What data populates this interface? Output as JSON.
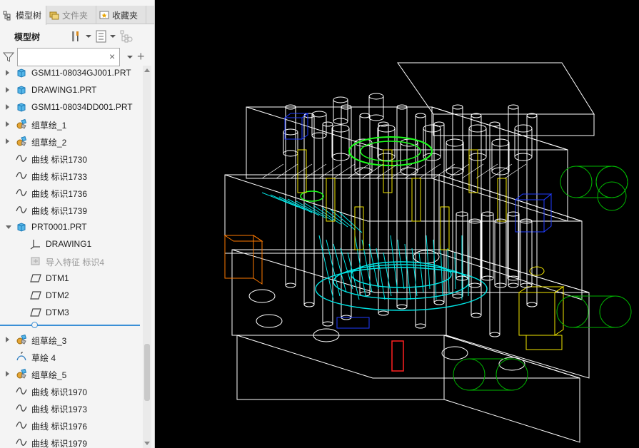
{
  "tabs": [
    {
      "label": "模型树",
      "icon": "model-tree-icon"
    },
    {
      "label": "文件夹",
      "icon": "folder-browser-icon"
    },
    {
      "label": "收藏夹",
      "icon": "favorites-icon"
    }
  ],
  "toolbar": {
    "title": "模型树",
    "settings_icon": "tools-icon",
    "show_icon": "list-settings-icon",
    "extra_icon": "tree-columns-icon"
  },
  "filter": {
    "value": "",
    "placeholder": "",
    "clear_glyph": "×",
    "add_glyph": "+"
  },
  "tree": [
    {
      "label": "GSM11-08034GJ001.PRT",
      "icon": "part-icon",
      "indent": 0,
      "exp": "closed"
    },
    {
      "label": "DRAWING1.PRT",
      "icon": "part-icon",
      "indent": 0,
      "exp": "closed"
    },
    {
      "label": "GSM11-08034DD001.PRT",
      "icon": "part-icon",
      "indent": 0,
      "exp": "closed"
    },
    {
      "label": "组草绘_1",
      "icon": "group-icon",
      "indent": 0,
      "exp": "closed"
    },
    {
      "label": "组草绘_2",
      "icon": "group-icon",
      "indent": 0,
      "exp": "closed"
    },
    {
      "label": "曲线 标识1730",
      "icon": "curve-icon",
      "indent": 0,
      "exp": "none"
    },
    {
      "label": "曲线 标识1733",
      "icon": "curve-icon",
      "indent": 0,
      "exp": "none"
    },
    {
      "label": "曲线 标识1736",
      "icon": "curve-icon",
      "indent": 0,
      "exp": "none"
    },
    {
      "label": "曲线 标识1739",
      "icon": "curve-icon",
      "indent": 0,
      "exp": "none"
    },
    {
      "label": "PRT0001.PRT",
      "icon": "part-icon",
      "indent": 0,
      "exp": "open"
    },
    {
      "label": "DRAWING1",
      "icon": "csys-icon",
      "indent": 1,
      "exp": "none"
    },
    {
      "label": "导入特征 标识4",
      "icon": "import-feature-icon",
      "indent": 1,
      "exp": "none",
      "dim": true
    },
    {
      "label": "DTM1",
      "icon": "datum-plane-icon",
      "indent": 1,
      "exp": "none"
    },
    {
      "label": "DTM2",
      "icon": "datum-plane-icon",
      "indent": 1,
      "exp": "none"
    },
    {
      "label": "DTM3",
      "icon": "datum-plane-icon",
      "indent": 1,
      "exp": "none"
    },
    {
      "label": "组草绘_3",
      "icon": "group-icon",
      "indent": 0,
      "exp": "closed"
    },
    {
      "label": "草绘 4",
      "icon": "sketch-icon",
      "indent": 0,
      "exp": "none"
    },
    {
      "label": "组草绘_5",
      "icon": "group-icon",
      "indent": 0,
      "exp": "closed"
    },
    {
      "label": "曲线 标识1970",
      "icon": "curve-icon",
      "indent": 0,
      "exp": "none"
    },
    {
      "label": "曲线 标识1973",
      "icon": "curve-icon",
      "indent": 0,
      "exp": "none"
    },
    {
      "label": "曲线 标识1976",
      "icon": "curve-icon",
      "indent": 0,
      "exp": "none"
    },
    {
      "label": "曲线 标识1979",
      "icon": "curve-icon",
      "indent": 0,
      "exp": "none"
    }
  ],
  "viewport": {
    "background": "#000000",
    "frame_color": "#ffffff",
    "accent_colors": [
      "#00e5e5",
      "#f2e600",
      "#1aff1a",
      "#1f3cff",
      "#ff7a00",
      "#ff2020",
      "#00b400"
    ]
  }
}
